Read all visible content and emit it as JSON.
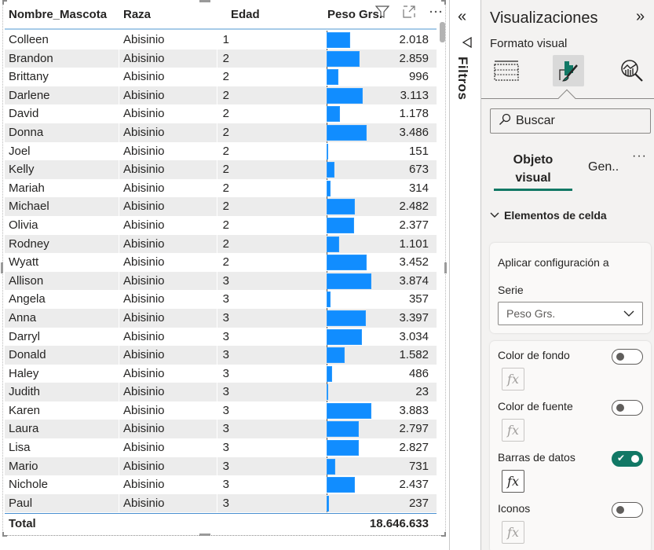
{
  "table": {
    "columns": [
      "Nombre_Mascota",
      "Raza",
      "Edad",
      "Peso Grs."
    ],
    "bar_color": "#118dff",
    "bar_max_value": 3883,
    "rows": [
      {
        "name": "Colleen",
        "raza": "Abisinio",
        "edad": "1",
        "peso": "2.018",
        "peso_value": 2018
      },
      {
        "name": "Brandon",
        "raza": "Abisinio",
        "edad": "2",
        "peso": "2.859",
        "peso_value": 2859
      },
      {
        "name": "Brittany",
        "raza": "Abisinio",
        "edad": "2",
        "peso": "996",
        "peso_value": 996
      },
      {
        "name": "Darlene",
        "raza": "Abisinio",
        "edad": "2",
        "peso": "3.113",
        "peso_value": 3113
      },
      {
        "name": "David",
        "raza": "Abisinio",
        "edad": "2",
        "peso": "1.178",
        "peso_value": 1178
      },
      {
        "name": "Donna",
        "raza": "Abisinio",
        "edad": "2",
        "peso": "3.486",
        "peso_value": 3486
      },
      {
        "name": "Joel",
        "raza": "Abisinio",
        "edad": "2",
        "peso": "151",
        "peso_value": 151
      },
      {
        "name": "Kelly",
        "raza": "Abisinio",
        "edad": "2",
        "peso": "673",
        "peso_value": 673
      },
      {
        "name": "Mariah",
        "raza": "Abisinio",
        "edad": "2",
        "peso": "314",
        "peso_value": 314
      },
      {
        "name": "Michael",
        "raza": "Abisinio",
        "edad": "2",
        "peso": "2.482",
        "peso_value": 2482
      },
      {
        "name": "Olivia",
        "raza": "Abisinio",
        "edad": "2",
        "peso": "2.377",
        "peso_value": 2377
      },
      {
        "name": "Rodney",
        "raza": "Abisinio",
        "edad": "2",
        "peso": "1.101",
        "peso_value": 1101
      },
      {
        "name": "Wyatt",
        "raza": "Abisinio",
        "edad": "2",
        "peso": "3.452",
        "peso_value": 3452
      },
      {
        "name": "Allison",
        "raza": "Abisinio",
        "edad": "3",
        "peso": "3.874",
        "peso_value": 3874
      },
      {
        "name": "Angela",
        "raza": "Abisinio",
        "edad": "3",
        "peso": "357",
        "peso_value": 357
      },
      {
        "name": "Anna",
        "raza": "Abisinio",
        "edad": "3",
        "peso": "3.397",
        "peso_value": 3397
      },
      {
        "name": "Darryl",
        "raza": "Abisinio",
        "edad": "3",
        "peso": "3.034",
        "peso_value": 3034
      },
      {
        "name": "Donald",
        "raza": "Abisinio",
        "edad": "3",
        "peso": "1.582",
        "peso_value": 1582
      },
      {
        "name": "Haley",
        "raza": "Abisinio",
        "edad": "3",
        "peso": "486",
        "peso_value": 486
      },
      {
        "name": "Judith",
        "raza": "Abisinio",
        "edad": "3",
        "peso": "23",
        "peso_value": 23
      },
      {
        "name": "Karen",
        "raza": "Abisinio",
        "edad": "3",
        "peso": "3.883",
        "peso_value": 3883
      },
      {
        "name": "Laura",
        "raza": "Abisinio",
        "edad": "3",
        "peso": "2.797",
        "peso_value": 2797
      },
      {
        "name": "Lisa",
        "raza": "Abisinio",
        "edad": "3",
        "peso": "2.827",
        "peso_value": 2827
      },
      {
        "name": "Mario",
        "raza": "Abisinio",
        "edad": "3",
        "peso": "731",
        "peso_value": 731
      },
      {
        "name": "Nichole",
        "raza": "Abisinio",
        "edad": "3",
        "peso": "2.437",
        "peso_value": 2437
      },
      {
        "name": "Paul",
        "raza": "Abisinio",
        "edad": "3",
        "peso": "237",
        "peso_value": 237
      }
    ],
    "total_label": "Total",
    "total_value": "18.646.633",
    "header_icons": [
      "filter-icon",
      "focus-mode-icon",
      "more-options-icon"
    ]
  },
  "filters_pane": {
    "label": "Filtros",
    "collapse_icon": "«",
    "funnel_icon": "filter-icon"
  },
  "viz_pane": {
    "title": "Visualizaciones",
    "expand_icon": "»",
    "subtitle": "Formato visual",
    "tabs": [
      "build-visual-icon",
      "format-visual-icon",
      "analytics-icon"
    ],
    "active_tab": 1,
    "search_placeholder": "Buscar",
    "subtabs": {
      "objeto_line1": "Objeto",
      "objeto_line2": "visual",
      "general": "Gen..",
      "more": "···"
    },
    "section": "Elementos de celda",
    "apply_title": "Aplicar configuración a",
    "serie_label": "Serie",
    "serie_value": "Peso Grs.",
    "options": [
      {
        "label": "Color de fondo",
        "on": false
      },
      {
        "label": "Color de fuente",
        "on": false
      },
      {
        "label": "Barras de datos",
        "on": true
      },
      {
        "label": "Iconos",
        "on": false
      }
    ],
    "fx_label": "fx",
    "accent_color": "#117865"
  }
}
